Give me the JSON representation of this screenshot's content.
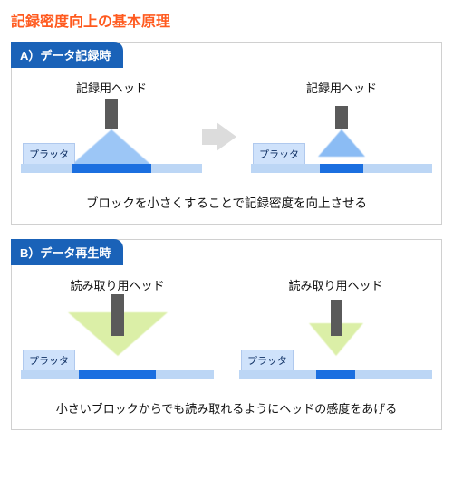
{
  "title": "記録密度向上の基本原理",
  "panelA": {
    "tab": "A）データ記録時",
    "leftHead": "記録用ヘッド",
    "rightHead": "記録用ヘッド",
    "platter": "プラッタ",
    "caption": "ブロックを小さくすることで記録密度を向上させる"
  },
  "panelB": {
    "tab": "B）データ再生時",
    "leftHead": "読み取り用ヘッド",
    "rightHead": "読み取り用ヘッド",
    "platter": "プラッタ",
    "caption": "小さいブロックからでも読み取れるようにヘッドの感度をあげる"
  },
  "colors": {
    "accent_title": "#ff5a1f",
    "tab_bg": "#1a62b8",
    "platter_light": "#bcd6f5",
    "platter_dark": "#1b6fe0",
    "write_cone": "rgba(90,160,240,0.6)",
    "read_cone": "rgba(200,230,120,0.65)",
    "head": "#5a5a5a",
    "arrow": "#dcdcdc"
  }
}
